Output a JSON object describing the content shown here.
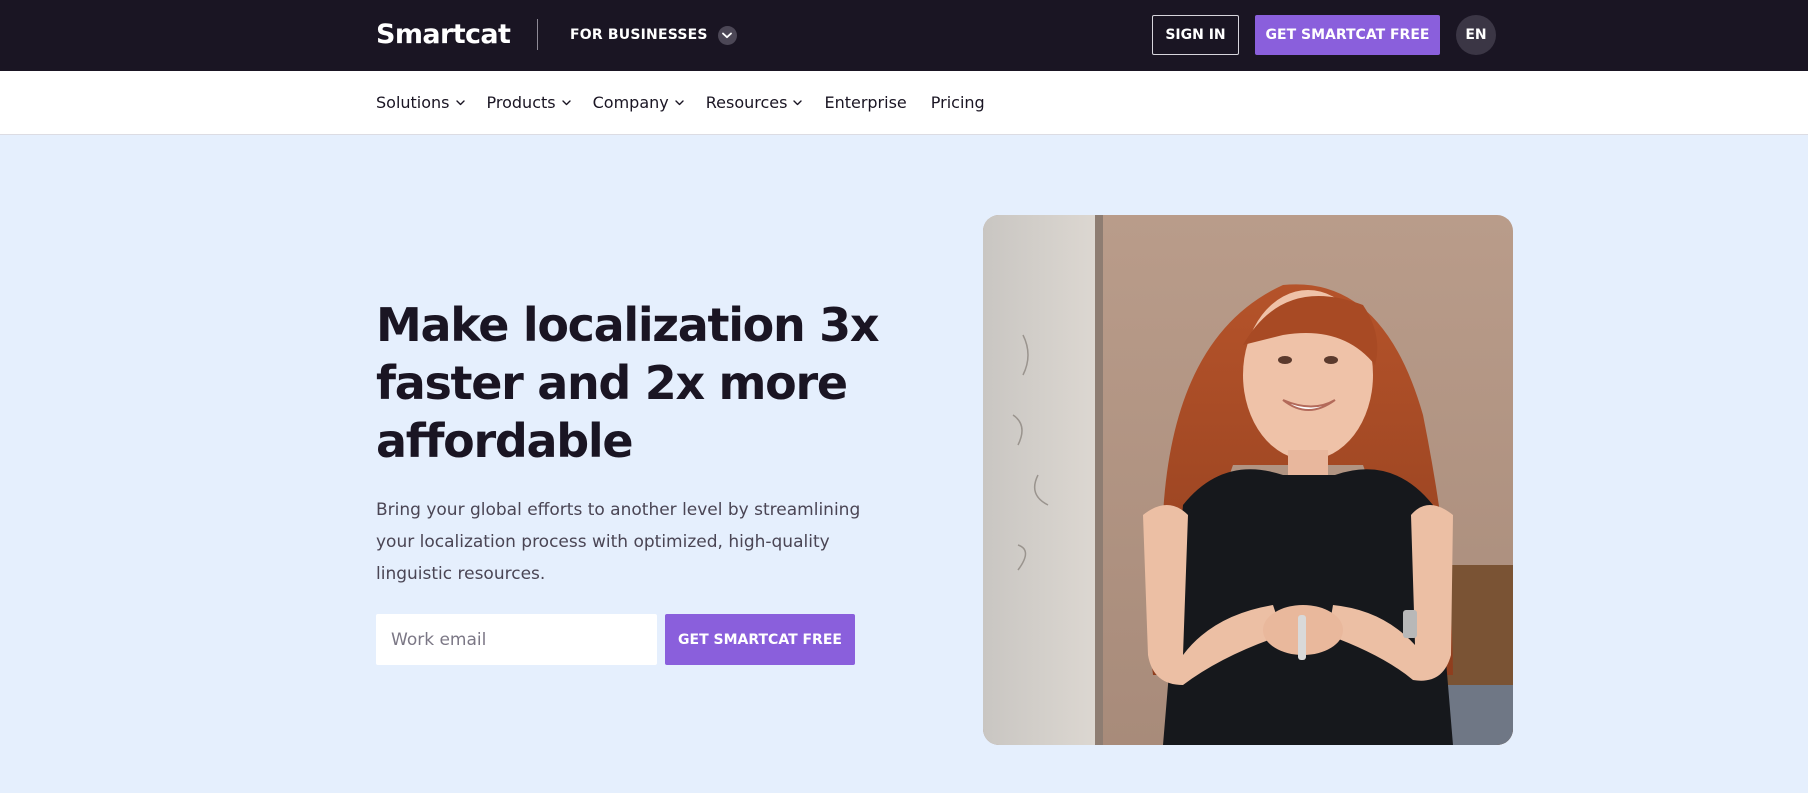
{
  "header": {
    "logo_text": "Smartcat",
    "audience_switch": "FOR BUSINESSES",
    "sign_in_label": "SIGN IN",
    "get_free_label": "GET SMARTCAT FREE",
    "language": "EN"
  },
  "nav": {
    "items": [
      {
        "label": "Solutions",
        "has_dropdown": true
      },
      {
        "label": "Products",
        "has_dropdown": true
      },
      {
        "label": "Company",
        "has_dropdown": true
      },
      {
        "label": "Resources",
        "has_dropdown": true
      },
      {
        "label": "Enterprise",
        "has_dropdown": false
      },
      {
        "label": "Pricing",
        "has_dropdown": false
      }
    ]
  },
  "hero": {
    "title_lines": [
      "Make localization 3x",
      "faster and 2x more",
      "affordable"
    ],
    "subtitle_lines": [
      "Bring your global efforts to another level by streamlining",
      "your localization process with optimized, high-quality",
      "linguistic resources."
    ],
    "email_placeholder": "Work email",
    "email_value": "",
    "cta_label": "GET SMARTCAT FREE"
  },
  "icons": {
    "audience_chevron": "chevron-down-circle-icon",
    "nav_chevron": "chevron-down-icon"
  },
  "colors": {
    "topbar_bg": "#1a1523",
    "accent_purple": "#8a5fdc",
    "hero_bg": "#e5effd",
    "lang_badge_bg": "#3b3645"
  }
}
